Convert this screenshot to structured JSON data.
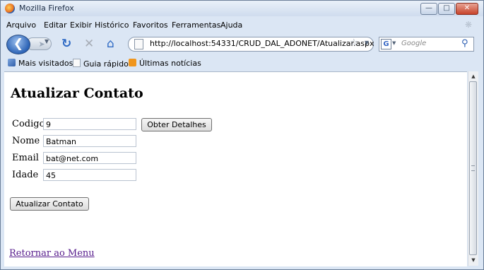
{
  "window": {
    "title": "Mozilla Firefox"
  },
  "menu": [
    "Arquivo",
    "Editar",
    "Exibir",
    "Histórico",
    "Favoritos",
    "Ferramentas",
    "Ajuda"
  ],
  "nav": {
    "url": "http://localhost:54331/CRUD_DAL_ADONET/Atualizar.aspx",
    "search_placeholder": "Google"
  },
  "bookmarks": [
    "Mais visitados",
    "Guia rápido",
    "Últimas notícias"
  ],
  "page": {
    "title": "Atualizar Contato",
    "fields": [
      {
        "label": "Codigo",
        "value": "9"
      },
      {
        "label": "Nome",
        "value": "Batman"
      },
      {
        "label": "Email",
        "value": "bat@net.com"
      },
      {
        "label": "Idade",
        "value": "45"
      }
    ],
    "details_button": "Obter Detalhes",
    "update_button": "Atualizar Contato",
    "back_link": "Retornar ao Menu"
  }
}
